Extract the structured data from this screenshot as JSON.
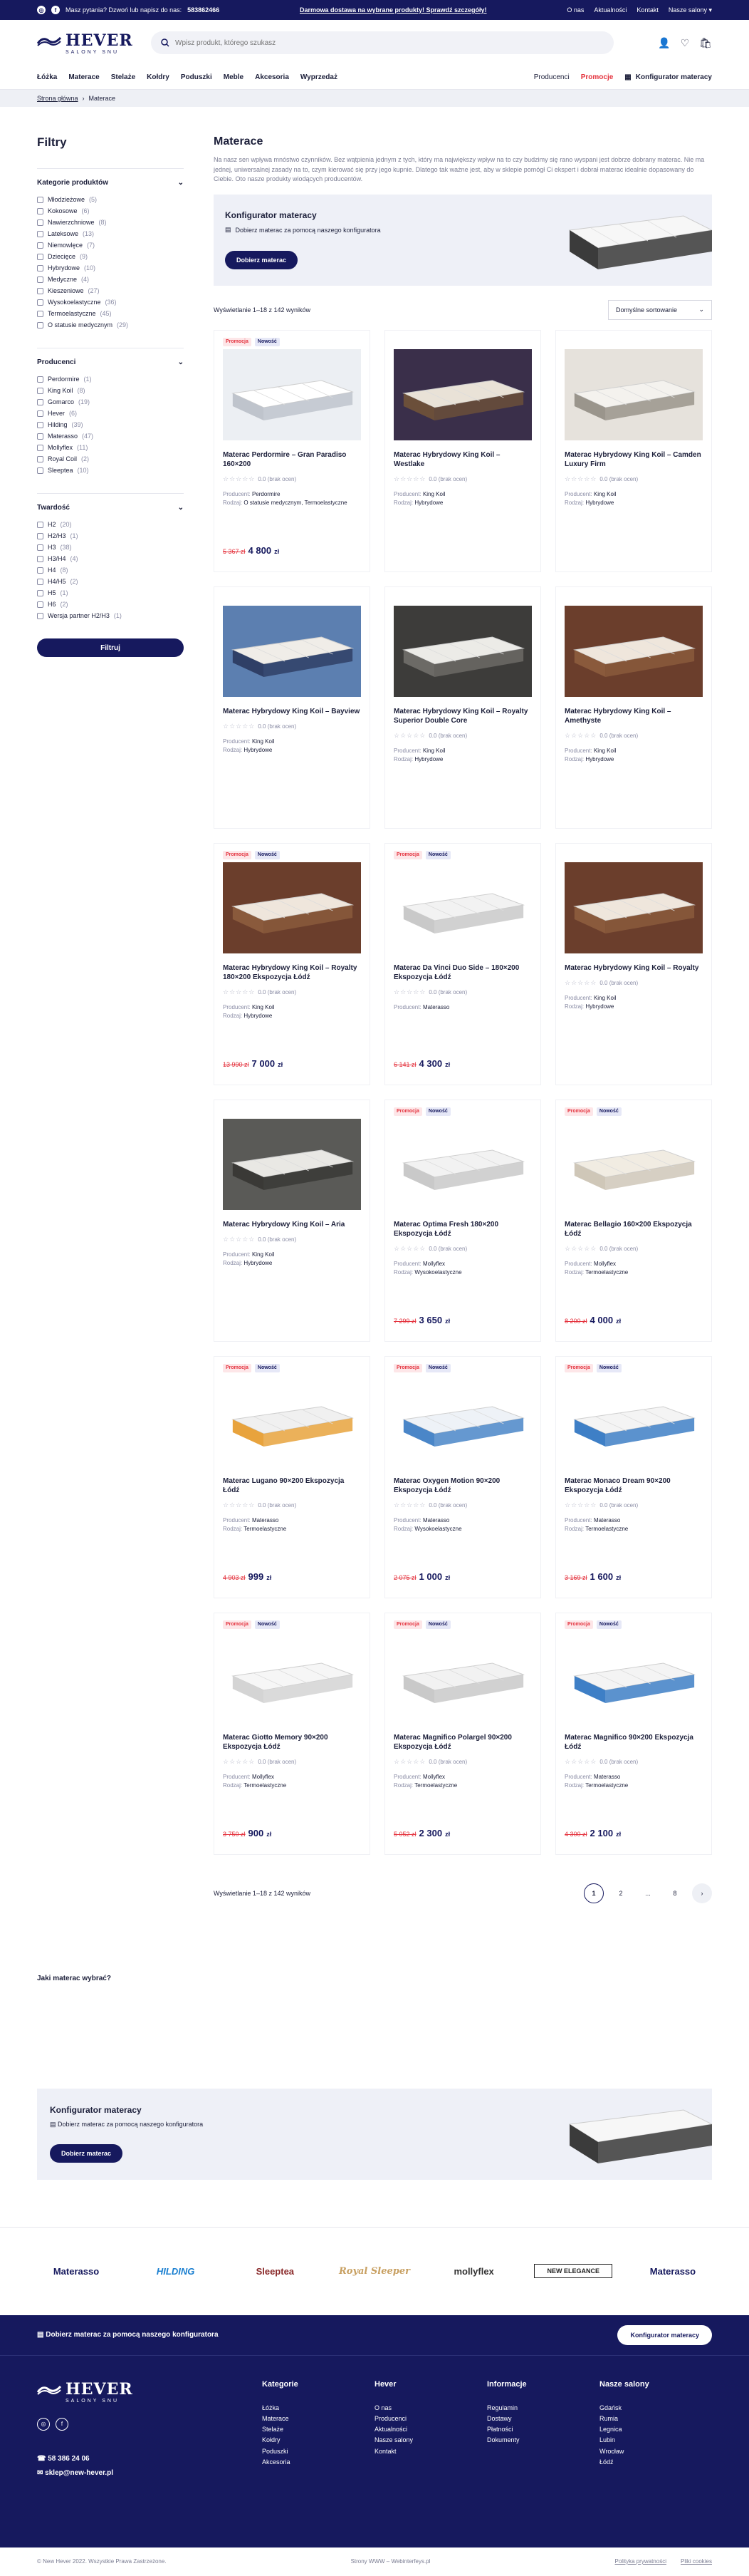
{
  "topbar": {
    "help": "Masz pytania? Dzwoń lub napisz do nas:",
    "phone": "583862466",
    "promo": "Darmowa dostawa na wybrane produkty! Sprawdź szczegóły!",
    "links": [
      "O nas",
      "Aktualności",
      "Kontakt"
    ],
    "salons": "Nasze salony"
  },
  "logo": {
    "name": "HEVER",
    "sub": "SALONY SNU"
  },
  "search": {
    "placeholder": "Wpisz produkt, którego szukasz"
  },
  "nav": {
    "items": [
      "Łóżka",
      "Materace",
      "Stelaże",
      "Kołdry",
      "Poduszki",
      "Meble",
      "Akcesoria",
      "Wyprzedaż"
    ],
    "producers": "Producenci",
    "promo": "Promocje",
    "config": "Konfigurator materacy"
  },
  "breadcrumb": {
    "home": "Strona główna",
    "current": "Materace"
  },
  "sidebar": {
    "title": "Filtry",
    "categories": {
      "title": "Kategorie produktów",
      "options": [
        {
          "label": "Młodzieżowe",
          "count": "(5)"
        },
        {
          "label": "Kokosowe",
          "count": "(6)"
        },
        {
          "label": "Nawierzchniowe",
          "count": "(8)"
        },
        {
          "label": "Lateksowe",
          "count": "(13)"
        },
        {
          "label": "Niemowlęce",
          "count": "(7)"
        },
        {
          "label": "Dziecięce",
          "count": "(9)"
        },
        {
          "label": "Hybrydowe",
          "count": "(10)"
        },
        {
          "label": "Medyczne",
          "count": "(4)"
        },
        {
          "label": "Kieszeniowe",
          "count": "(27)"
        },
        {
          "label": "Wysokoelastyczne",
          "count": "(36)"
        },
        {
          "label": "Termoelastyczne",
          "count": "(45)"
        },
        {
          "label": "O statusie medycznym",
          "count": "(29)"
        }
      ]
    },
    "producers": {
      "title": "Producenci",
      "options": [
        {
          "label": "Perdormire",
          "count": "(1)"
        },
        {
          "label": "King Koil",
          "count": "(8)"
        },
        {
          "label": "Gomarco",
          "count": "(19)"
        },
        {
          "label": "Hever",
          "count": "(6)"
        },
        {
          "label": "Hilding",
          "count": "(39)"
        },
        {
          "label": "Materasso",
          "count": "(47)"
        },
        {
          "label": "Mollyflex",
          "count": "(11)"
        },
        {
          "label": "Royal Coil",
          "count": "(2)"
        },
        {
          "label": "Sleeptea",
          "count": "(10)"
        }
      ]
    },
    "hardness": {
      "title": "Twardość",
      "options": [
        {
          "label": "H2",
          "count": "(20)"
        },
        {
          "label": "H2/H3",
          "count": "(1)"
        },
        {
          "label": "H3",
          "count": "(38)"
        },
        {
          "label": "H3/H4",
          "count": "(4)"
        },
        {
          "label": "H4",
          "count": "(8)"
        },
        {
          "label": "H4/H5",
          "count": "(2)"
        },
        {
          "label": "H5",
          "count": "(1)"
        },
        {
          "label": "H6",
          "count": "(2)"
        },
        {
          "label": "Wersja partner H2/H3",
          "count": "(1)"
        }
      ]
    },
    "filter_button": "Filtruj"
  },
  "main": {
    "title": "Materace",
    "description": "Na nasz sen wpływa mnóstwo czynników. Bez wątpienia jednym z tych, który ma największy wpływ na to czy budzimy się rano wyspani jest dobrze dobrany materac. Nie ma jednej, uniwersalnej zasady na to, czym kierować się przy jego kupnie. Dlatego tak ważne jest, aby w sklepie pomógł Ci ekspert i dobrał materac idealnie dopasowany do Ciebie. Oto nasze produkty wiodących producentów.",
    "config": {
      "title": "Konfigurator materacy",
      "subtitle": "Dobierz materac za pomocą naszego konfiguratora",
      "button": "Dobierz materac"
    },
    "results": "Wyświetlanie 1–18 z 142 wyników",
    "sort": "Domyślne sortowanie",
    "pager_text": "Wyświetlanie 1–18 z 142 wyników",
    "pages": [
      "1",
      "2",
      "...",
      "8",
      "›"
    ]
  },
  "labels": {
    "producer": "Producent:",
    "kind": "Rodzaj:",
    "reviews": "0.0 (brak ocen)",
    "currency": "zł",
    "promo": "Promocja",
    "new": "Nowość"
  },
  "products": [
    {
      "name": "Materac Perdormire – Gran Paradiso 160×200",
      "producer": "Perdormire",
      "kind": "O statusie medycznym, Termoelastyczne",
      "old": "5 367 zł",
      "price": "4 800",
      "promo": true,
      "isnew": true,
      "img": "white"
    },
    {
      "name": "Materac Hybrydowy King Koil – Westlake",
      "producer": "King Koil",
      "kind": "Hybrydowe",
      "old": "",
      "price": "",
      "promo": false,
      "isnew": false,
      "img": "night"
    },
    {
      "name": "Materac Hybrydowy King Koil – Camden Luxury Firm",
      "producer": "King Koil",
      "kind": "Hybrydowe",
      "old": "",
      "price": "",
      "promo": false,
      "isnew": false,
      "img": "room"
    },
    {
      "name": "Materac Hybrydowy King Koil – Bayview",
      "producer": "King Koil",
      "kind": "Hybrydowe",
      "old": "",
      "price": "",
      "promo": false,
      "isnew": false,
      "img": "sky"
    },
    {
      "name": "Materac Hybrydowy King Koil – Royalty Superior Double Core",
      "producer": "King Koil",
      "kind": "Hybrydowe",
      "old": "",
      "price": "",
      "promo": false,
      "isnew": false,
      "img": "dark"
    },
    {
      "name": "Materac Hybrydowy King Koil – Amethyste",
      "producer": "King Koil",
      "kind": "Hybrydowe",
      "old": "",
      "price": "",
      "promo": false,
      "isnew": false,
      "img": "brown"
    },
    {
      "name": "Materac Hybrydowy King Koil – Royalty 180×200 Ekspozycja Łódź",
      "producer": "King Koil",
      "kind": "Hybrydowe",
      "old": "13 990 zł",
      "price": "7 000",
      "promo": true,
      "isnew": true,
      "img": "brown"
    },
    {
      "name": "Materac Da Vinci Duo Side – 180×200 Ekspozycja Łódź",
      "producer": "Materasso",
      "kind": "",
      "old": "6 141 zł",
      "price": "4 300",
      "promo": true,
      "isnew": true,
      "img": "plain"
    },
    {
      "name": "Materac Hybrydowy King Koil – Royalty",
      "producer": "King Koil",
      "kind": "Hybrydowe",
      "old": "",
      "price": "",
      "promo": false,
      "isnew": false,
      "img": "brown"
    },
    {
      "name": "Materac Hybrydowy King Koil – Aria",
      "producer": "King Koil",
      "kind": "Hybrydowe",
      "old": "",
      "price": "",
      "promo": false,
      "isnew": false,
      "img": "grey"
    },
    {
      "name": "Materac Optima Fresh 180×200 Ekspozycja Łódź",
      "producer": "Mollyflex",
      "kind": "Wysokoelastyczne",
      "old": "7 299 zł",
      "price": "3 650",
      "promo": true,
      "isnew": true,
      "img": "plain"
    },
    {
      "name": "Materac Bellagio 160×200 Ekspozycja Łódź",
      "producer": "Mollyflex",
      "kind": "Termoelastyczne",
      "old": "8 200 zł",
      "price": "4 000",
      "promo": true,
      "isnew": true,
      "img": "cream"
    },
    {
      "name": "Materac Lugano 90×200 Ekspozycja Łódź",
      "producer": "Materasso",
      "kind": "Termoelastyczne",
      "old": "4 903 zł",
      "price": "999",
      "promo": true,
      "isnew": true,
      "img": "layered"
    },
    {
      "name": "Materac Oxygen Motion 90×200 Ekspozycja Łódź",
      "producer": "Materasso",
      "kind": "Wysokoelastyczne",
      "old": "2 075 zł",
      "price": "1 000",
      "promo": true,
      "isnew": true,
      "img": "foam"
    },
    {
      "name": "Materac Monaco Dream 90×200 Ekspozycja Łódź",
      "producer": "Materasso",
      "kind": "Termoelastyczne",
      "old": "3 169 zł",
      "price": "1 600",
      "promo": true,
      "isnew": true,
      "img": "blue"
    },
    {
      "name": "Materac Giotto Memory 90×200 Ekspozycja Łódź",
      "producer": "Mollyflex",
      "kind": "Termoelastyczne",
      "old": "3 750 zł",
      "price": "900",
      "promo": true,
      "isnew": true,
      "img": "flat"
    },
    {
      "name": "Materac Magnifico Polargel 90×200 Ekspozycja Łódź",
      "producer": "Mollyflex",
      "kind": "Termoelastyczne",
      "old": "5 052 zł",
      "price": "2 300",
      "promo": true,
      "isnew": true,
      "img": "plain"
    },
    {
      "name": "Materac Magnifico 90×200 Ekspozycja Łódź",
      "producer": "Materasso",
      "kind": "Termoelastyczne",
      "old": "4 300 zł",
      "price": "2 100",
      "promo": true,
      "isnew": true,
      "img": "blue"
    }
  ],
  "faq": {
    "title": "Jaki materac wybrać?"
  },
  "brands": [
    "Materasso",
    "HILDING",
    "Sleeptea",
    "Royal Sleeper",
    "mollyflex",
    "NEW ELEGANCE",
    "Materasso"
  ],
  "cta": {
    "text": "Dobierz materac za pomocą naszego konfiguratora",
    "button": "Konfigurator materacy"
  },
  "footer": {
    "phone": "58 386 24 06",
    "email": "sklep@new-hever.pl",
    "cols": [
      {
        "title": "Kategorie",
        "items": [
          "Łóżka",
          "Materace",
          "Stelaże",
          "Kołdry",
          "Poduszki",
          "Akcesoria"
        ]
      },
      {
        "title": "Hever",
        "items": [
          "O nas",
          "Producenci",
          "Aktualności",
          "Nasze salony",
          "Kontakt"
        ]
      },
      {
        "title": "Informacje",
        "items": [
          "Regulamin",
          "Dostawy",
          "Płatności",
          "Dokumenty"
        ]
      },
      {
        "title": "Nasze salony",
        "items": [
          "Gdańsk",
          "Rumia",
          "Legnica",
          "Lubin",
          "Wrocław",
          "Łódź"
        ]
      }
    ]
  },
  "legal": {
    "copy": "© New Hever 2022. Wszystkie Prawa Zastrzeżone.",
    "made": "Strony WWW – Webinterfeys.pl",
    "privacy": "Polityka prywatności",
    "cookies": "Pliki cookies"
  },
  "colors": {
    "brand": "#16195e",
    "accent": "#e4323d",
    "panel": "#eef0f7"
  }
}
